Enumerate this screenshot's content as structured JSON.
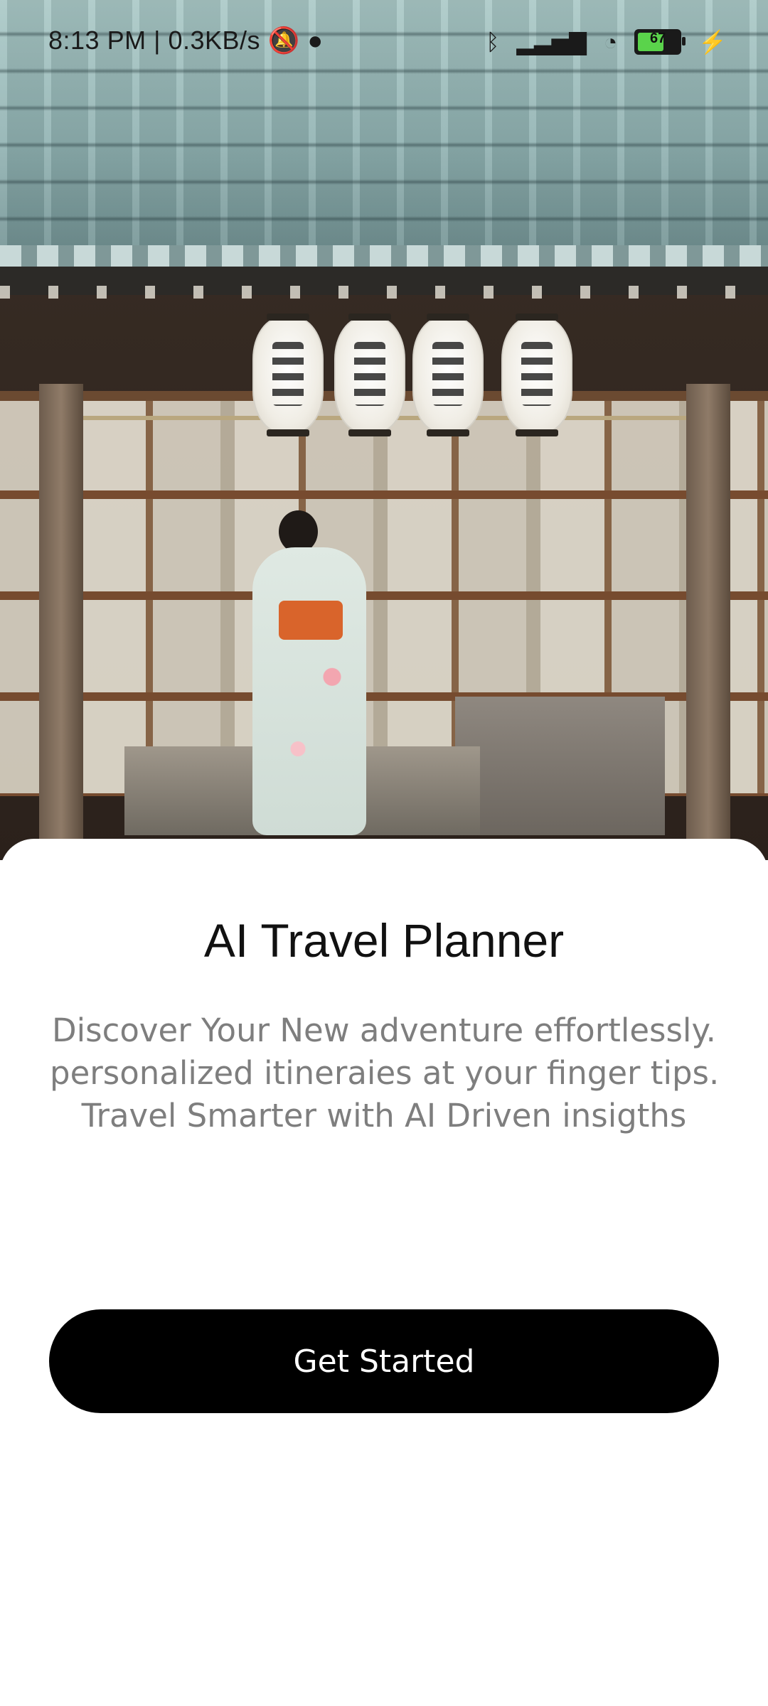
{
  "status_bar": {
    "time": "8:13 PM",
    "network_speed": "0.3KB/s",
    "battery_level": "67",
    "icons": [
      "bluetooth-icon",
      "signal-icon",
      "wifi-icon",
      "battery-icon",
      "charging-icon"
    ]
  },
  "hero": {
    "image_description": "Japanese shrine with paper lanterns and a woman in kimono"
  },
  "content": {
    "title": "AI Travel Planner",
    "description_lines": [
      "Discover Your New adventure effortlessly.",
      "personalized itineraies at your finger tips.",
      "Travel Smarter with AI Driven insigths"
    ],
    "cta_label": "Get Started"
  },
  "colors": {
    "primary_button": "#000000",
    "title_text": "#111111",
    "body_text": "#7e7e7e"
  }
}
